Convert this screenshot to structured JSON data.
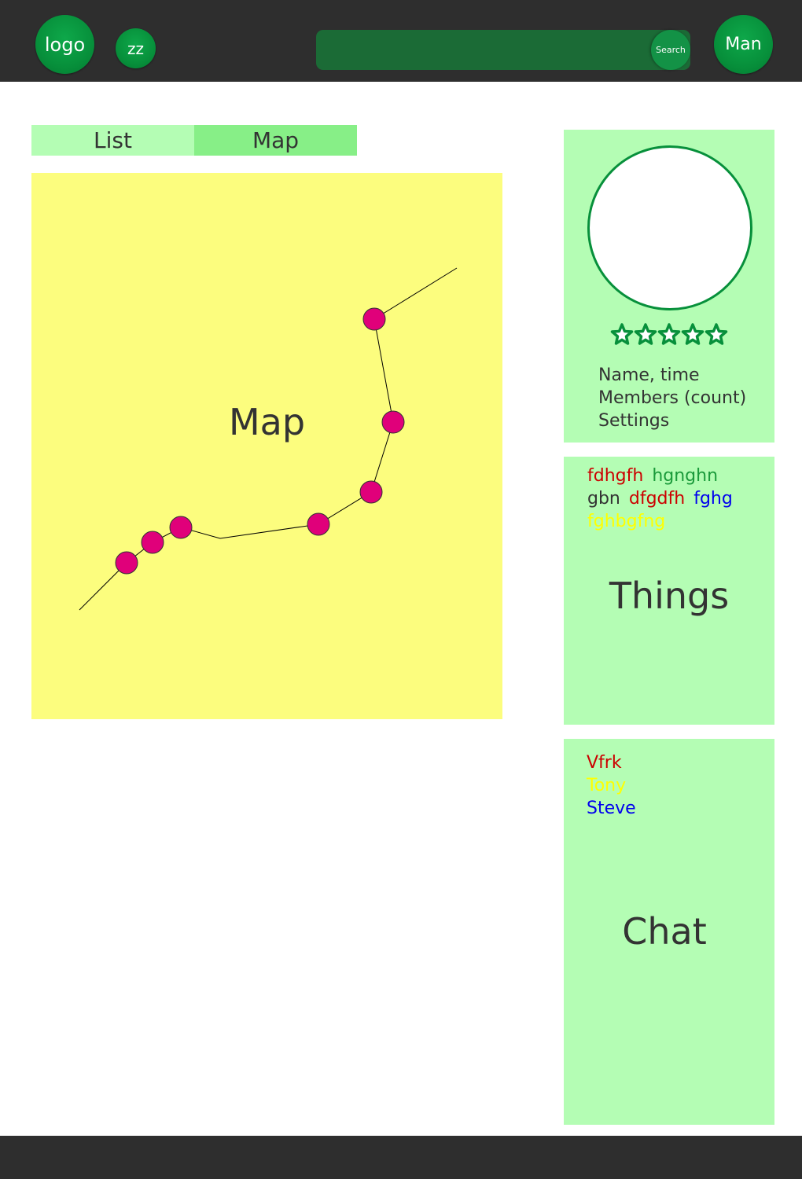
{
  "header": {
    "logo_label": "logo",
    "zz_label": "zz",
    "search": {
      "value": "",
      "placeholder": "",
      "button_label": "Search"
    },
    "user_label": "Man"
  },
  "tabs": [
    {
      "label": "List",
      "active": false
    },
    {
      "label": "Map",
      "active": true
    }
  ],
  "map": {
    "label": "Map",
    "route_color": "#000000",
    "marker_color": "#e0007a",
    "background": "#fcfd7e"
  },
  "profile": {
    "rating_stars": 5,
    "lines": [
      "Name, time",
      "Members (count)",
      "Settings"
    ]
  },
  "things": {
    "title": "Things",
    "words": [
      {
        "text": "fdhgfh",
        "color": "#cc0000"
      },
      {
        "text": "hgnghn",
        "color": "#1a9a3a"
      },
      {
        "text": "gbn",
        "color": "#333333"
      },
      {
        "text": "dfgdfh",
        "color": "#cc0000"
      },
      {
        "text": "fghg",
        "color": "#0000ee"
      },
      {
        "text": "fghbgfng",
        "color": "#ffff00"
      }
    ]
  },
  "chat": {
    "title": "Chat",
    "names": [
      {
        "text": "Vfrk",
        "color": "#cc0000"
      },
      {
        "text": "Tony",
        "color": "#ffff00"
      },
      {
        "text": "Steve",
        "color": "#0000ee"
      }
    ]
  },
  "colors": {
    "header_bg": "#2e2e2e",
    "accent_green": "#07903b",
    "card_bg": "#b4fdb4",
    "tab_active_bg": "#87ef87"
  }
}
